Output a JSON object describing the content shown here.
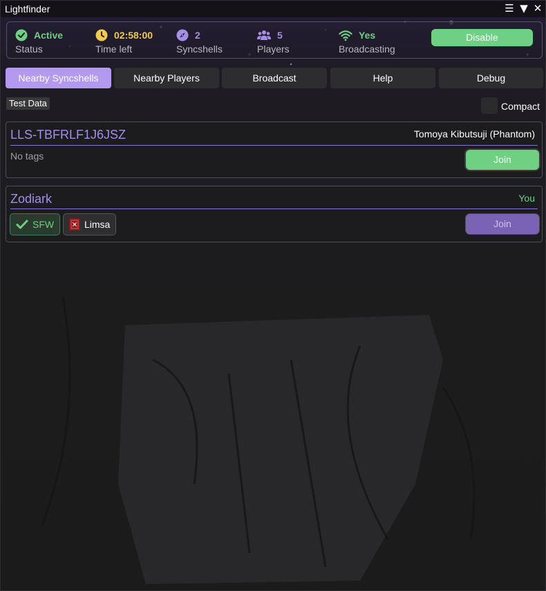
{
  "window": {
    "title": "Lightfinder",
    "menu_icon": "hamburger-menu-icon",
    "collapse_icon": "triangle-down-icon",
    "close_icon": "close-icon"
  },
  "status": {
    "active": {
      "value": "Active",
      "label": "Status",
      "icon": "check-circle-icon",
      "color": "#6fcf83"
    },
    "time_left": {
      "value": "02:58:00",
      "label": "Time left",
      "icon": "clock-icon",
      "color": "#f2c94c"
    },
    "syncshells": {
      "value": "2",
      "label": "Syncshells",
      "icon": "compass-icon",
      "color": "#a48ee8"
    },
    "players": {
      "value": "5",
      "label": "Players",
      "icon": "users-icon",
      "color": "#a48ee8"
    },
    "broadcasting": {
      "value": "Yes",
      "label": "Broadcasting",
      "icon": "wifi-icon",
      "color": "#6fcf83"
    },
    "disable_label": "Disable"
  },
  "tabs": [
    {
      "label": "Nearby Syncshells",
      "active": true
    },
    {
      "label": "Nearby Players",
      "active": false
    },
    {
      "label": "Broadcast",
      "active": false
    },
    {
      "label": "Help",
      "active": false
    },
    {
      "label": "Debug",
      "active": false
    }
  ],
  "test_data_label": "Test Data",
  "compact_label": "Compact",
  "compact_checked": false,
  "syncshells": [
    {
      "name": "LLS-TBFRLF1J6JSZ",
      "owner": "Tomoya Kibutsuji (Phantom)",
      "tags_text": "No tags",
      "join_label": "Join",
      "join_color": "#6fcf83"
    },
    {
      "name": "Zodiark",
      "owner": "You",
      "owner_color": "#6fcf83",
      "tags": [
        {
          "label": "SFW",
          "icon": "checkmark-icon",
          "color": "#6fcf83"
        },
        {
          "label": "Limsa",
          "icon": "limsa-emblem-icon"
        }
      ],
      "join_label": "Join",
      "join_color": "#7a63b4"
    }
  ],
  "colors": {
    "accent": "#a48ee8",
    "tab_active": "#b399f0",
    "success": "#6fcf83",
    "warning": "#f2c94c"
  }
}
